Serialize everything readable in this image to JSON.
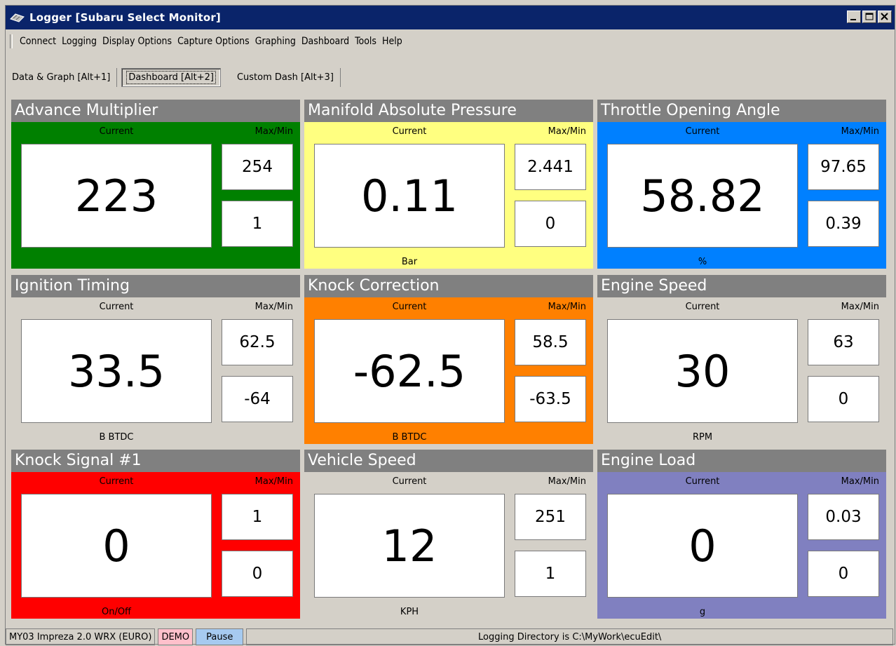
{
  "window": {
    "title": "Logger [Subaru Select Monitor]",
    "minimize_glyph": "_",
    "maximize_glyph": "□",
    "close_glyph": "×",
    "title_color": "#0a246a"
  },
  "menu": {
    "items": [
      "Connect",
      "Logging",
      "Display Options",
      "Capture Options",
      "Graphing",
      "Dashboard",
      "Tools",
      "Help"
    ]
  },
  "tabs": [
    {
      "label": "Data & Graph [Alt+1]",
      "active": false
    },
    {
      "label": "Dashboard [Alt+2]",
      "active": true
    },
    {
      "label": "Custom Dash [Alt+3]",
      "active": false
    }
  ],
  "gauges": [
    {
      "title": "Advance Multiplier",
      "current_label": "Current",
      "maxmin_label": "Max/Min",
      "current": "223",
      "max": "254",
      "min": "1",
      "unit": "",
      "color": "#008000"
    },
    {
      "title": "Manifold Absolute Pressure",
      "current_label": "Current",
      "maxmin_label": "Max/Min",
      "current": "0.11",
      "max": "2.441",
      "min": "0",
      "unit": "Bar",
      "color": "#ffff80"
    },
    {
      "title": "Throttle Opening Angle",
      "current_label": "Current",
      "maxmin_label": "Max/Min",
      "current": "58.82",
      "max": "97.65",
      "min": "0.39",
      "unit": "%",
      "color": "#0080ff"
    },
    {
      "title": "Ignition Timing",
      "current_label": "Current",
      "maxmin_label": "Max/Min",
      "current": "33.5",
      "max": "62.5",
      "min": "-64",
      "unit": "B BTDC",
      "color": "#d4d0c8"
    },
    {
      "title": "Knock Correction",
      "current_label": "Current",
      "maxmin_label": "Max/Min",
      "current": "-62.5",
      "max": "58.5",
      "min": "-63.5",
      "unit": "B BTDC",
      "color": "#ff8000"
    },
    {
      "title": "Engine Speed",
      "current_label": "Current",
      "maxmin_label": "Max/Min",
      "current": "30",
      "max": "63",
      "min": "0",
      "unit": "RPM",
      "color": "#d4d0c8"
    },
    {
      "title": "Knock Signal #1",
      "current_label": "Current",
      "maxmin_label": "Max/Min",
      "current": "0",
      "max": "1",
      "min": "0",
      "unit": "On/Off",
      "color": "#ff0000"
    },
    {
      "title": "Vehicle Speed",
      "current_label": "Current",
      "maxmin_label": "Max/Min",
      "current": "12",
      "max": "251",
      "min": "1",
      "unit": "KPH",
      "color": "#d4d0c8"
    },
    {
      "title": "Engine Load",
      "current_label": "Current",
      "maxmin_label": "Max/Min",
      "current": "0",
      "max": "0.03",
      "min": "0",
      "unit": "g",
      "color": "#8080c0"
    }
  ],
  "status": {
    "vehicle": "MY03 Impreza 2.0 WRX (EURO)",
    "demo": "DEMO",
    "pause": "Pause",
    "directory": "Logging Directory is C:\\MyWork\\ecuEdit\\"
  }
}
